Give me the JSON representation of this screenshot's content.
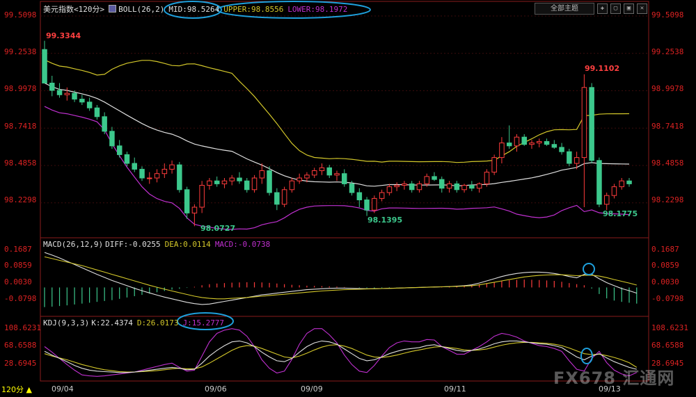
{
  "header": {
    "symbol": "美元指数<120分>",
    "boll_name": "BOLL(26,2)",
    "mid": "MID:98.5264",
    "upper": "UPPER:98.8556",
    "lower": "LOWER:98.1972",
    "theme_button": "全部主题"
  },
  "macd_header": {
    "name": "MACD(26,12,9)",
    "diff": "DIFF:-0.0255",
    "dea": "DEA:0.0114",
    "macd": "MACD:-0.0738"
  },
  "kdj_header": {
    "name": "KDJ(9,3,3)",
    "k": "K:22.4374",
    "d": "D:26.0173",
    "j": "J:15.2777"
  },
  "price_axis": [
    "99.5098",
    "99.2538",
    "98.9978",
    "98.7418",
    "98.4858",
    "98.2298"
  ],
  "macd_axis": [
    "0.1687",
    "0.0859",
    "0.0030",
    "-0.0798"
  ],
  "kdj_axis": [
    "108.6231",
    "68.6588",
    "28.6945"
  ],
  "annotations": {
    "high1": "99.3344",
    "low1": "98.0727",
    "low2": "98.1395",
    "high2": "99.1102",
    "low3": "98.1775"
  },
  "period_label": "120分 ▲",
  "x_labels": [
    "09/04",
    "09/06",
    "09/09",
    "09/11",
    "09/13"
  ],
  "watermark": "FX678 汇通网",
  "colors": {
    "up": "#ff3c3c",
    "down": "#3cc88c",
    "mid": "#e0e0e0",
    "upper": "#d4c82a",
    "lower": "#c030d0",
    "highlight": "#1ea0dc"
  },
  "chart_data": {
    "type": "candlestick",
    "series": [
      {
        "candles": [
          [
            99.28,
            99.34,
            99.05,
            99.05
          ],
          [
            99.05,
            99.1,
            98.96,
            99.0
          ],
          [
            99.0,
            99.05,
            98.95,
            98.97
          ],
          [
            98.97,
            99.02,
            98.93,
            98.98
          ],
          [
            98.98,
            99.0,
            98.92,
            98.94
          ],
          [
            98.94,
            98.97,
            98.9,
            98.92
          ],
          [
            98.92,
            98.95,
            98.86,
            98.88
          ],
          [
            98.88,
            98.9,
            98.8,
            98.82
          ],
          [
            98.82,
            98.85,
            98.7,
            98.72
          ],
          [
            98.72,
            98.75,
            98.6,
            98.62
          ],
          [
            98.62,
            98.66,
            98.54,
            98.56
          ],
          [
            98.56,
            98.58,
            98.48,
            98.5
          ],
          [
            98.5,
            98.54,
            98.44,
            98.46
          ],
          [
            98.46,
            98.48,
            98.38,
            98.4
          ],
          [
            98.4,
            98.44,
            98.36,
            98.4
          ],
          [
            98.4,
            98.46,
            98.37,
            98.43
          ],
          [
            98.43,
            98.5,
            98.4,
            98.46
          ],
          [
            98.46,
            98.52,
            98.43,
            98.49
          ],
          [
            98.49,
            98.51,
            98.3,
            98.32
          ],
          [
            98.32,
            98.34,
            98.12,
            98.16
          ],
          [
            98.16,
            98.22,
            98.07,
            98.2
          ],
          [
            98.2,
            98.38,
            98.16,
            98.35
          ],
          [
            98.35,
            98.4,
            98.32,
            98.38
          ],
          [
            98.38,
            98.41,
            98.34,
            98.36
          ],
          [
            98.36,
            98.4,
            98.33,
            98.38
          ],
          [
            98.38,
            98.42,
            98.35,
            98.4
          ],
          [
            98.4,
            98.44,
            98.36,
            98.38
          ],
          [
            98.38,
            98.4,
            98.3,
            98.32
          ],
          [
            98.32,
            98.42,
            98.3,
            98.4
          ],
          [
            98.4,
            98.5,
            98.36,
            98.45
          ],
          [
            98.45,
            98.48,
            98.28,
            98.3
          ],
          [
            98.3,
            98.33,
            98.18,
            98.22
          ],
          [
            98.22,
            98.34,
            98.2,
            98.32
          ],
          [
            98.32,
            98.4,
            98.3,
            98.38
          ],
          [
            98.38,
            98.43,
            98.36,
            98.4
          ],
          [
            98.4,
            98.44,
            98.37,
            98.42
          ],
          [
            98.42,
            98.47,
            98.4,
            98.45
          ],
          [
            98.45,
            98.5,
            98.42,
            98.47
          ],
          [
            98.47,
            98.49,
            98.4,
            98.42
          ],
          [
            98.42,
            98.45,
            98.38,
            98.43
          ],
          [
            98.43,
            98.46,
            98.34,
            98.36
          ],
          [
            98.36,
            98.38,
            98.28,
            98.3
          ],
          [
            98.3,
            98.33,
            98.2,
            98.25
          ],
          [
            98.25,
            98.27,
            98.14,
            98.18
          ],
          [
            98.18,
            98.28,
            98.16,
            98.26
          ],
          [
            98.26,
            98.32,
            98.24,
            98.3
          ],
          [
            98.3,
            98.36,
            98.28,
            98.34
          ],
          [
            98.34,
            98.37,
            98.31,
            98.35
          ],
          [
            98.35,
            98.38,
            98.32,
            98.36
          ],
          [
            98.36,
            98.38,
            98.3,
            98.32
          ],
          [
            98.32,
            98.38,
            98.3,
            98.36
          ],
          [
            98.36,
            98.43,
            98.34,
            98.41
          ],
          [
            98.41,
            98.44,
            98.38,
            98.39
          ],
          [
            98.39,
            98.41,
            98.3,
            98.33
          ],
          [
            98.33,
            98.38,
            98.3,
            98.36
          ],
          [
            98.36,
            98.38,
            98.3,
            98.32
          ],
          [
            98.32,
            98.36,
            98.3,
            98.35
          ],
          [
            98.35,
            98.38,
            98.31,
            98.33
          ],
          [
            98.33,
            98.37,
            98.3,
            98.36
          ],
          [
            98.36,
            98.46,
            98.34,
            98.44
          ],
          [
            98.44,
            98.56,
            98.42,
            98.54
          ],
          [
            98.54,
            98.68,
            98.5,
            98.64
          ],
          [
            98.64,
            98.76,
            98.6,
            98.62
          ],
          [
            98.62,
            98.7,
            98.58,
            98.68
          ],
          [
            98.68,
            98.7,
            98.62,
            98.63
          ],
          [
            98.63,
            98.66,
            98.6,
            98.64
          ],
          [
            98.64,
            98.67,
            98.61,
            98.65
          ],
          [
            98.65,
            98.67,
            98.62,
            98.63
          ],
          [
            98.63,
            98.66,
            98.6,
            98.61
          ],
          [
            98.61,
            98.64,
            98.56,
            98.58
          ],
          [
            98.58,
            98.6,
            98.48,
            98.5
          ],
          [
            98.5,
            98.58,
            98.46,
            98.54
          ],
          [
            98.54,
            99.11,
            98.2,
            99.02
          ],
          [
            99.02,
            99.05,
            98.5,
            98.52
          ],
          [
            98.52,
            98.54,
            98.2,
            98.22
          ],
          [
            98.22,
            98.3,
            98.18,
            98.28
          ],
          [
            98.28,
            98.36,
            98.26,
            98.34
          ],
          [
            98.34,
            98.4,
            98.32,
            98.38
          ],
          [
            98.38,
            98.4,
            98.34,
            98.36
          ]
        ]
      }
    ],
    "overlays": [
      "MID",
      "UPPER",
      "LOWER"
    ],
    "ylim": [
      98.0,
      99.6
    ],
    "macd": {
      "bars": [
        -0.09,
        -0.088,
        -0.085,
        -0.082,
        -0.078,
        -0.074,
        -0.07,
        -0.066,
        -0.062,
        -0.058,
        -0.052,
        -0.046,
        -0.04,
        -0.034,
        -0.028,
        -0.022,
        -0.016,
        -0.01,
        -0.006,
        -0.002,
        0.003,
        0.01,
        0.015,
        0.018,
        0.02,
        0.022,
        0.023,
        0.024,
        0.024,
        0.023,
        0.021,
        0.018,
        0.015,
        0.012,
        0.01,
        0.008,
        0.007,
        0.006,
        0.005,
        0.004,
        0.002,
        0.0,
        -0.002,
        -0.003,
        -0.004,
        -0.003,
        -0.002,
        -0.001,
        0.0,
        0.001,
        0.002,
        0.003,
        0.004,
        0.005,
        0.006,
        0.008,
        0.01,
        0.012,
        0.015,
        0.02,
        0.025,
        0.03,
        0.033,
        0.035,
        0.036,
        0.035,
        0.034,
        0.032,
        0.03,
        0.026,
        0.02,
        0.015,
        0.01,
        -0.005,
        -0.03,
        -0.05,
        -0.06,
        -0.066,
        -0.07,
        -0.074
      ],
      "diff": [
        0.16,
        0.148,
        0.135,
        0.12,
        0.105,
        0.09,
        0.075,
        0.06,
        0.046,
        0.032,
        0.02,
        0.008,
        -0.004,
        -0.015,
        -0.025,
        -0.035,
        -0.044,
        -0.052,
        -0.06,
        -0.068,
        -0.074,
        -0.078,
        -0.076,
        -0.07,
        -0.064,
        -0.058,
        -0.052,
        -0.046,
        -0.04,
        -0.034,
        -0.03,
        -0.026,
        -0.022,
        -0.018,
        -0.014,
        -0.01,
        -0.008,
        -0.006,
        -0.004,
        -0.003,
        -0.003,
        -0.004,
        -0.005,
        -0.006,
        -0.006,
        -0.005,
        -0.004,
        -0.003,
        -0.002,
        -0.001,
        0.0,
        0.001,
        0.002,
        0.003,
        0.004,
        0.006,
        0.008,
        0.012,
        0.02,
        0.03,
        0.04,
        0.05,
        0.058,
        0.064,
        0.068,
        0.07,
        0.07,
        0.068,
        0.064,
        0.058,
        0.05,
        0.044,
        0.06,
        0.06,
        0.04,
        0.022,
        0.008,
        -0.005,
        -0.015,
        -0.026
      ],
      "dea": [
        0.14,
        0.132,
        0.124,
        0.116,
        0.108,
        0.1,
        0.09,
        0.08,
        0.07,
        0.06,
        0.05,
        0.04,
        0.03,
        0.02,
        0.01,
        0.001,
        -0.008,
        -0.016,
        -0.024,
        -0.032,
        -0.04,
        -0.046,
        -0.05,
        -0.052,
        -0.052,
        -0.05,
        -0.048,
        -0.046,
        -0.043,
        -0.04,
        -0.037,
        -0.034,
        -0.031,
        -0.028,
        -0.025,
        -0.022,
        -0.019,
        -0.016,
        -0.014,
        -0.012,
        -0.01,
        -0.009,
        -0.008,
        -0.007,
        -0.006,
        -0.005,
        -0.004,
        -0.003,
        -0.002,
        -0.001,
        0.0,
        0.001,
        0.002,
        0.003,
        0.004,
        0.005,
        0.006,
        0.008,
        0.012,
        0.018,
        0.024,
        0.03,
        0.036,
        0.042,
        0.048,
        0.052,
        0.055,
        0.057,
        0.058,
        0.058,
        0.056,
        0.054,
        0.055,
        0.056,
        0.052,
        0.045,
        0.036,
        0.028,
        0.02,
        0.011
      ]
    },
    "kdj": {
      "k": [
        60,
        52,
        45,
        38,
        30,
        24,
        20,
        18,
        17,
        16,
        15,
        15,
        16,
        18,
        20,
        22,
        24,
        26,
        24,
        21,
        22,
        35,
        50,
        62,
        72,
        80,
        82,
        78,
        70,
        58,
        48,
        40,
        38,
        45,
        58,
        70,
        78,
        82,
        80,
        75,
        65,
        55,
        45,
        40,
        42,
        48,
        55,
        60,
        64,
        66,
        68,
        72,
        74,
        70,
        66,
        62,
        60,
        62,
        65,
        70,
        76,
        80,
        82,
        82,
        80,
        78,
        76,
        75,
        72,
        68,
        58,
        48,
        42,
        50,
        55,
        46,
        38,
        32,
        26,
        22
      ],
      "d": [
        55,
        50,
        46,
        42,
        37,
        32,
        28,
        24,
        21,
        19,
        17,
        16,
        16,
        17,
        18,
        19,
        21,
        23,
        24,
        23,
        23,
        27,
        35,
        44,
        53,
        62,
        69,
        72,
        71,
        66,
        60,
        54,
        48,
        46,
        50,
        56,
        63,
        69,
        73,
        74,
        71,
        66,
        59,
        52,
        48,
        47,
        49,
        52,
        56,
        60,
        63,
        66,
        69,
        70,
        68,
        66,
        63,
        62,
        63,
        65,
        69,
        73,
        76,
        78,
        79,
        79,
        78,
        77,
        75,
        72,
        67,
        61,
        55,
        53,
        54,
        51,
        47,
        42,
        36,
        26
      ],
      "j": [
        70,
        58,
        45,
        32,
        20,
        10,
        8,
        7,
        8,
        10,
        12,
        14,
        16,
        20,
        24,
        28,
        32,
        35,
        26,
        18,
        20,
        50,
        80,
        98,
        105,
        108,
        105,
        92,
        70,
        42,
        24,
        14,
        18,
        43,
        75,
        98,
        108,
        108,
        95,
        78,
        52,
        32,
        18,
        15,
        30,
        50,
        68,
        78,
        82,
        80,
        80,
        85,
        84,
        70,
        62,
        54,
        54,
        62,
        70,
        80,
        92,
        98,
        95,
        90,
        82,
        77,
        72,
        70,
        66,
        60,
        40,
        22,
        18,
        45,
        60,
        36,
        20,
        12,
        8,
        15
      ]
    }
  }
}
